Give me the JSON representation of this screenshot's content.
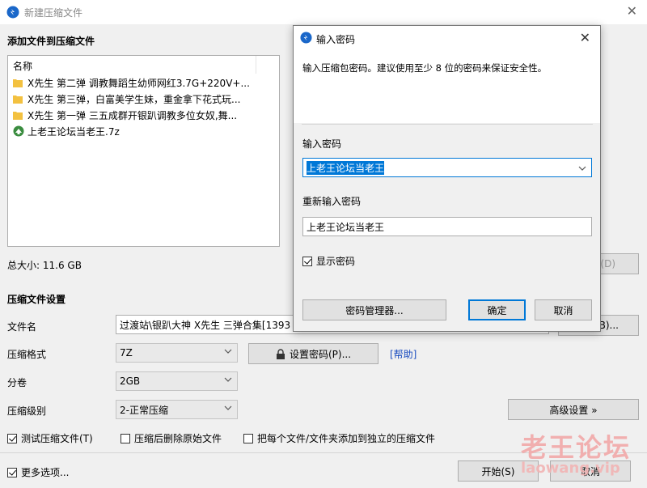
{
  "main": {
    "title": "新建压缩文件",
    "add_section": "添加文件到压缩文件",
    "list_header": "名称",
    "files": [
      {
        "name": "X先生 第二弹 调教舞蹈生幼师网红3.7G+220V+...",
        "type": "folder"
      },
      {
        "name": "X先生 第三弹，白富美学生妹，重金拿下花式玩...",
        "type": "folder"
      },
      {
        "name": "X先生 第一弹 三五成群开银趴调教多位女奴,舞...",
        "type": "folder"
      },
      {
        "name": "上老王论坛当老王.7z",
        "type": "file"
      }
    ],
    "total_size": "总大小: 11.6 GB",
    "delete_btn": "(D)",
    "settings_section": "压缩文件设置",
    "filename_label": "文件名",
    "filename_value": "过渡站\\银趴大神 X先生 三弹合集[1393",
    "browse_btn": "B)...",
    "format_label": "压缩格式",
    "format_value": "7Z",
    "set_password_btn": "设置密码(P)...",
    "help_link": "[帮助]",
    "volume_label": "分卷",
    "volume_value": "2GB",
    "level_label": "压缩级别",
    "level_value": "2-正常压缩",
    "advanced_btn": "高级设置 »",
    "test_check": "测试压缩文件(T)",
    "delete_after_check": "压缩后删除原始文件",
    "separate_check": "把每个文件/文件夹添加到独立的压缩文件",
    "more_options": "更多选项...",
    "start_btn": "开始(S)",
    "cancel_btn": "取消"
  },
  "dialog": {
    "title": "输入密码",
    "info": "输入压缩包密码。建议使用至少 8 位的密码来保证安全性。",
    "password_label": "输入密码",
    "password_value": "上老王论坛当老王",
    "confirm_label": "重新输入密码",
    "confirm_value": "上老王论坛当老王",
    "show_password": "显示密码",
    "manager_btn": "密码管理器...",
    "ok_btn": "确定",
    "cancel_btn": "取消"
  },
  "watermark": {
    "line1": "老王论坛",
    "line2": "laowang.vip"
  },
  "colors": {
    "accent": "#0078d7",
    "link": "#1b4dbf",
    "folder": "#f3c140"
  }
}
